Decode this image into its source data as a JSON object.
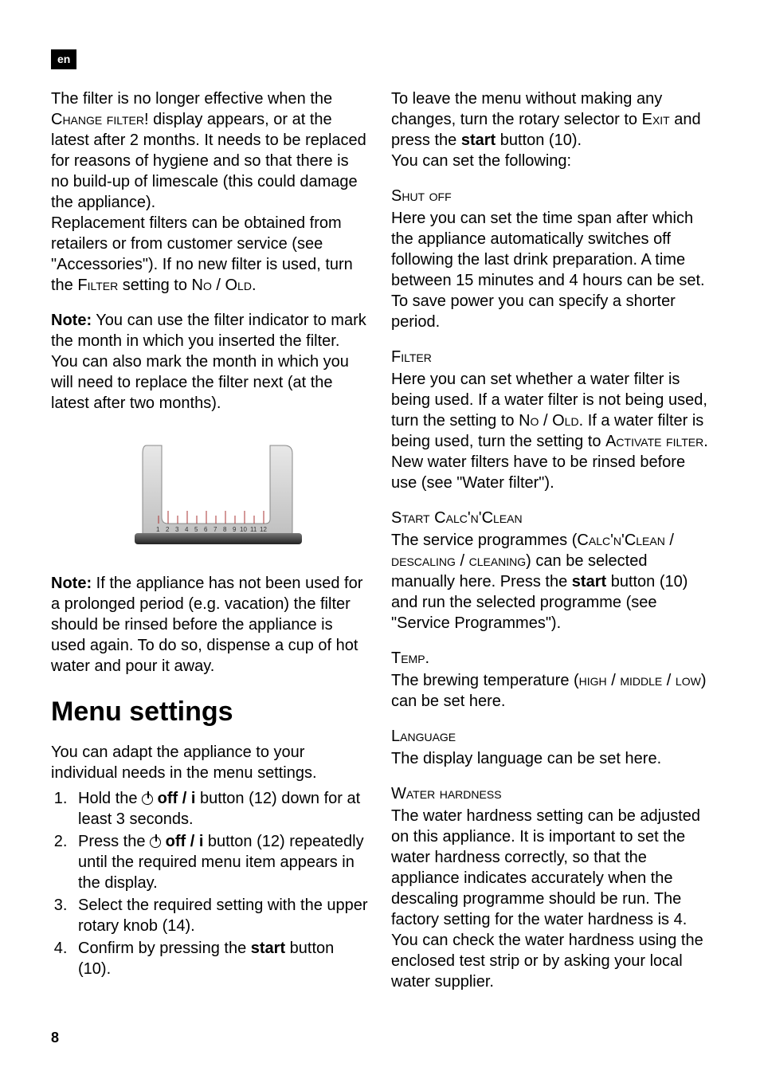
{
  "lang_badge": "en",
  "page_number": "8",
  "left": {
    "p1a": "The filter is no longer effective when the ",
    "p1a_sc": "Change filter!",
    "p1b": " display appears, or at the latest after 2 months. It needs to be replaced for reasons of hygiene and so that there is no build-up of limescale (this could damage the appliance).",
    "p2a": "Replacement filters can be obtained from retailers or from customer service (see \"Accessories\"). If no new filter is used, turn the ",
    "p2a_sc1": "Filter",
    "p2b": " setting to ",
    "p2b_sc2": "No / Old",
    "p2c": ".",
    "note1_label": "Note:",
    "note1_body": " You can use the filter indicator to mark the month in which you inserted the filter. You can also mark the month in which you will need to replace the filter next (at the latest after two months).",
    "note2_label": "Note:",
    "note2_body": " If the appliance has not been used for a prolonged period (e.g. vacation) the filter should be rinsed before the appliance is used again. To do so, dispense a cup of hot water and pour it away.",
    "h1": "Menu settings",
    "menu_intro": "You can adapt the appliance to your individual needs in the menu settings.",
    "steps": {
      "s1a": "Hold the ",
      "s1b_btn": "off / i",
      "s1c": " button (12) down for at least 3 seconds.",
      "s2a": "Press the ",
      "s2b_btn": "off / i",
      "s2c": " button (12) repeatedly until the required menu item appears in the display.",
      "s3": "Select the required setting with the upper rotary knob (14).",
      "s4a": "Confirm by pressing the ",
      "s4b_btn": "start",
      "s4c": " button (10)."
    }
  },
  "right": {
    "intro_a": "To leave the menu without making any changes, turn the rotary selector to ",
    "intro_sc": "Exit",
    "intro_b": " and press the ",
    "intro_btn": "start",
    "intro_c": " button (10).",
    "intro_follow": "You can set the following:",
    "shut_head": "Shut off",
    "shut_body": "Here you can set the time span after which the appliance automatically switches off following the last drink preparation. A time between 15 minutes and 4 hours can be set. To save power you can specify a shorter period.",
    "filter_head": "Filter",
    "filter_a": "Here you can set whether a water filter is being used. If a water filter is not being used, turn the setting to ",
    "filter_sc1": "No / Old",
    "filter_b": ". If a water filter is being used, turn the setting to ",
    "filter_sc2": "Activate filter",
    "filter_c": ". New water filters have to be rinsed before use (see \"Water filter\").",
    "start_head": "Start Calc'n'Clean",
    "start_a": "The service programmes (",
    "start_sc1": "Calc'n'Clean",
    "start_b": " / ",
    "start_sc2": "descaling",
    "start_c": " / ",
    "start_sc3": "cleaning",
    "start_d": ") can be selected manually here. Press the ",
    "start_btn": "start",
    "start_e": " button (10) and run the selected programme (see \"Service Programmes\").",
    "temp_head": "Temp.",
    "temp_a": "The brewing temperature (",
    "temp_sc1": "high",
    "temp_b": " / ",
    "temp_sc2": "middle",
    "temp_c": " / ",
    "temp_sc3": "low",
    "temp_d": ") can be set here.",
    "lang_head": "Language",
    "lang_body": "The display language can be set here.",
    "hard_head": "Water hardness",
    "hard_body": "The water hardness setting can be adjusted on this appliance. It is important to set the water hardness correctly, so that the appliance indicates accurately when the descaling programme should be run. The factory setting for the water hardness is 4. You can check the water hardness using the enclosed test strip or by asking your local water supplier."
  }
}
